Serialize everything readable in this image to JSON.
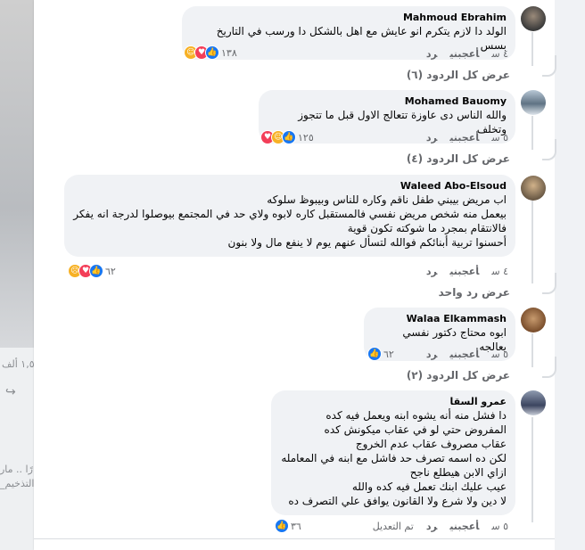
{
  "background_left": {
    "fragments": [
      "١,٥ ألف",
      "رًا .. مار",
      "_التذخيم"
    ]
  },
  "comments": [
    {
      "author": "Mahmoud Ebrahim",
      "text": "الولد دا لازم يتكرم انو عايش مع اهل بالشكل دا ورسب في التاريخ بسس",
      "time": "٤ س",
      "like": "أعجبني",
      "reply": "رد",
      "edited": "",
      "reaction_count": "١٣٨",
      "view_replies": "عرض كل الردود (٦)"
    },
    {
      "author": "Mohamed Bauomy",
      "text": "والله الناس دى عاوزة تتعالج الاول قبل ما تتجوز وتخلف",
      "time": "٥ س",
      "like": "أعجبني",
      "reply": "رد",
      "edited": "",
      "reaction_count": "١٢٥",
      "view_replies": "عرض كل الردود (٤)"
    },
    {
      "author": "Waleed Abo-Elsoud",
      "text": "اب مريض بيبني طفل ناقم وكاره للناس وبيبوظ سلوكه\nبيعمل منه شخص مريض نفسي فالمستقبل كاره لابوه ولاي حد في المجتمع بيوصلوا لدرجة انه يفكر فالانتقام بمجرد ما شوكته تكون قوية\nأحسنوا تربية أبنائكم فوالله لتسأل عنهم يوم لا ينفع مال ولا بنون",
      "time": "٤ س",
      "like": "أعجبني",
      "reply": "رد",
      "edited": "",
      "reaction_count": "٦٢",
      "view_replies": "عرض رد واحد"
    },
    {
      "author": "Walaa Elkammash",
      "text": "ابوه محتاج دكتور نفسي يعالجه",
      "time": "٥ س",
      "like": "أعجبني",
      "reply": "رد",
      "edited": "",
      "reaction_count": "٦٢",
      "view_replies": "عرض كل الردود (٢)"
    },
    {
      "author": "عمرو السقا",
      "text": "دا فشل منه أنه يشوه ابنه ويعمل فيه كده\nالمفروض حتي لو في عقاب ميكونش كده\nعقاب مصروف عقاب عدم الخروج\nلكن ده اسمه تصرف حد فاشل مع ابنه في المعامله\nازاي الابن هيطلع ناجح\nعيب عليك ابنك تعمل فيه كده والله\nلا دين ولا شرع ولا القانون يوافق علي التصرف ده",
      "time": "٥ س",
      "like": "أعجبني",
      "reply": "رد",
      "edited": "تم التعديل",
      "reaction_count": "٣٦",
      "view_replies": ""
    }
  ]
}
